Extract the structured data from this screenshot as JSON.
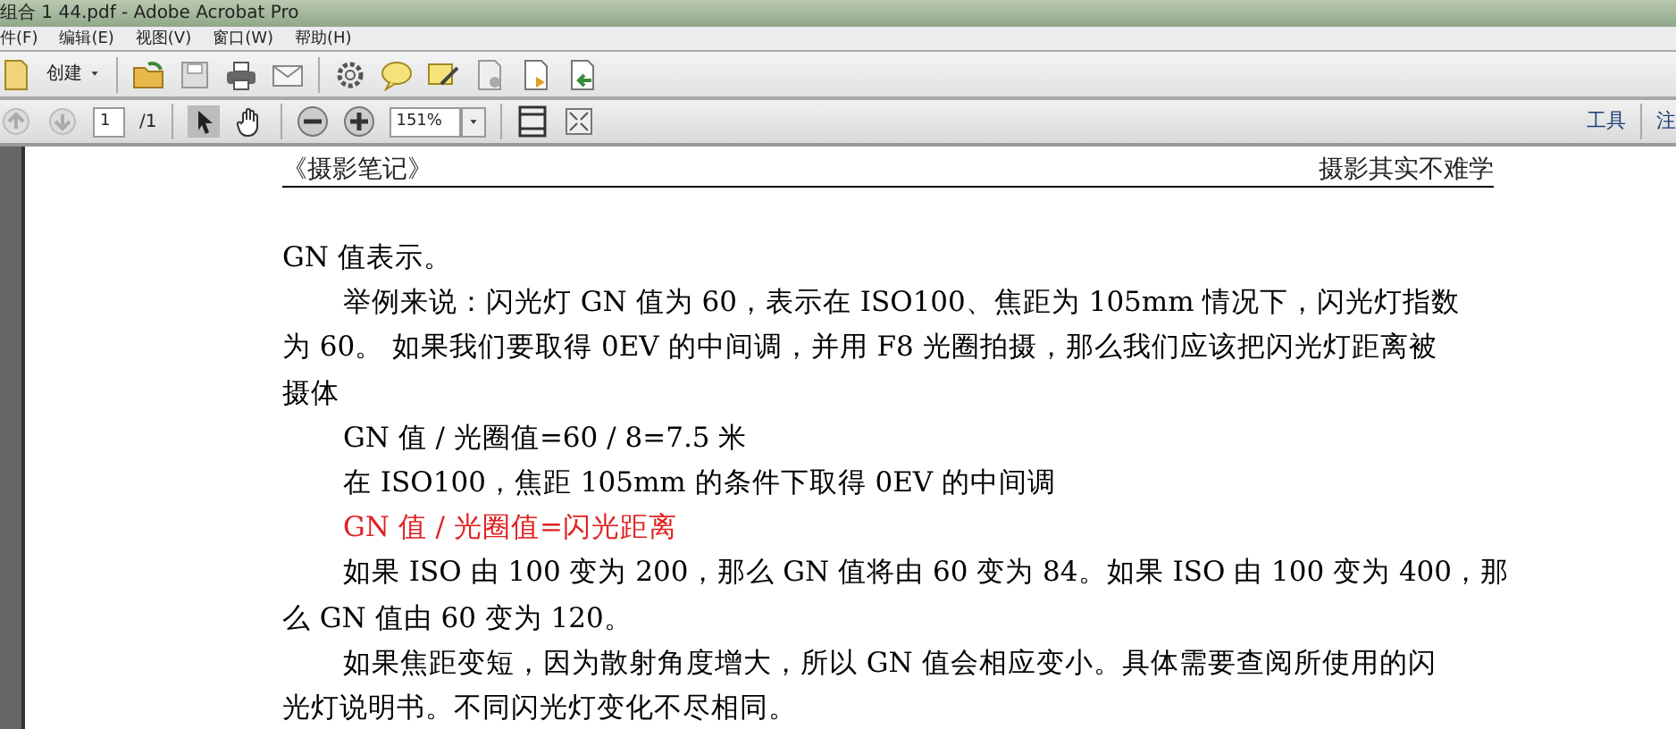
{
  "window": {
    "title": "组合 1 44.pdf - Adobe Acrobat Pro"
  },
  "menu": [
    "件(F)",
    "编辑(E)",
    "视图(V)",
    "窗口(W)",
    "帮助(H)"
  ],
  "toolbar": {
    "create_label": "创建",
    "tools": [
      {
        "kind": "open"
      },
      {
        "kind": "save"
      },
      {
        "kind": "print"
      },
      {
        "kind": "email"
      },
      {
        "kind": "settings"
      },
      {
        "kind": "comment"
      },
      {
        "kind": "sign"
      },
      {
        "kind": "page"
      },
      {
        "kind": "page-edit"
      },
      {
        "kind": "page-export"
      }
    ]
  },
  "nav": {
    "page": "1",
    "page_total": "/1",
    "zoom": "151%",
    "tools_label": "工具",
    "comment_label": "注"
  },
  "document": {
    "header_left": "《摄影笔记》",
    "header_right": "摄影其实不难学",
    "lines": [
      {
        "text": "GN 值表示。",
        "indent": false,
        "color": "#000000"
      },
      {
        "text": "举例来说：闪光灯 GN 值为 60，表示在 ISO100、焦距为 105mm 情况下，闪光灯指数",
        "indent": true,
        "color": "#000000"
      },
      {
        "text": "为 60。 如果我们要取得 0EV 的中间调，并用 F8 光圈拍摄，那么我们应该把闪光灯距离被",
        "indent": false,
        "color": "#000000"
      },
      {
        "text": "摄体",
        "indent": false,
        "color": "#000000"
      },
      {
        "text": "GN 值 / 光圈值=60 / 8=7.5 米",
        "indent": true,
        "color": "#000000"
      },
      {
        "text": "在 ISO100，焦距 105mm 的条件下取得 0EV 的中间调",
        "indent": true,
        "color": "#000000"
      },
      {
        "text": "GN 值 / 光圈值=闪光距离",
        "indent": true,
        "color": "#e02020"
      },
      {
        "text": "如果 ISO 由 100 变为 200，那么 GN 值将由 60 变为 84。如果 ISO 由 100 变为 400，那",
        "indent": true,
        "color": "#000000"
      },
      {
        "text": "么 GN 值由 60 变为 120。",
        "indent": false,
        "color": "#000000"
      },
      {
        "text": "如果焦距变短，因为散射角度增大，所以 GN 值会相应变小。具体需要查阅所使用的闪",
        "indent": true,
        "color": "#000000"
      },
      {
        "text": "光灯说明书。不同闪光灯变化不尽相同。",
        "indent": false,
        "color": "#000000"
      }
    ]
  }
}
